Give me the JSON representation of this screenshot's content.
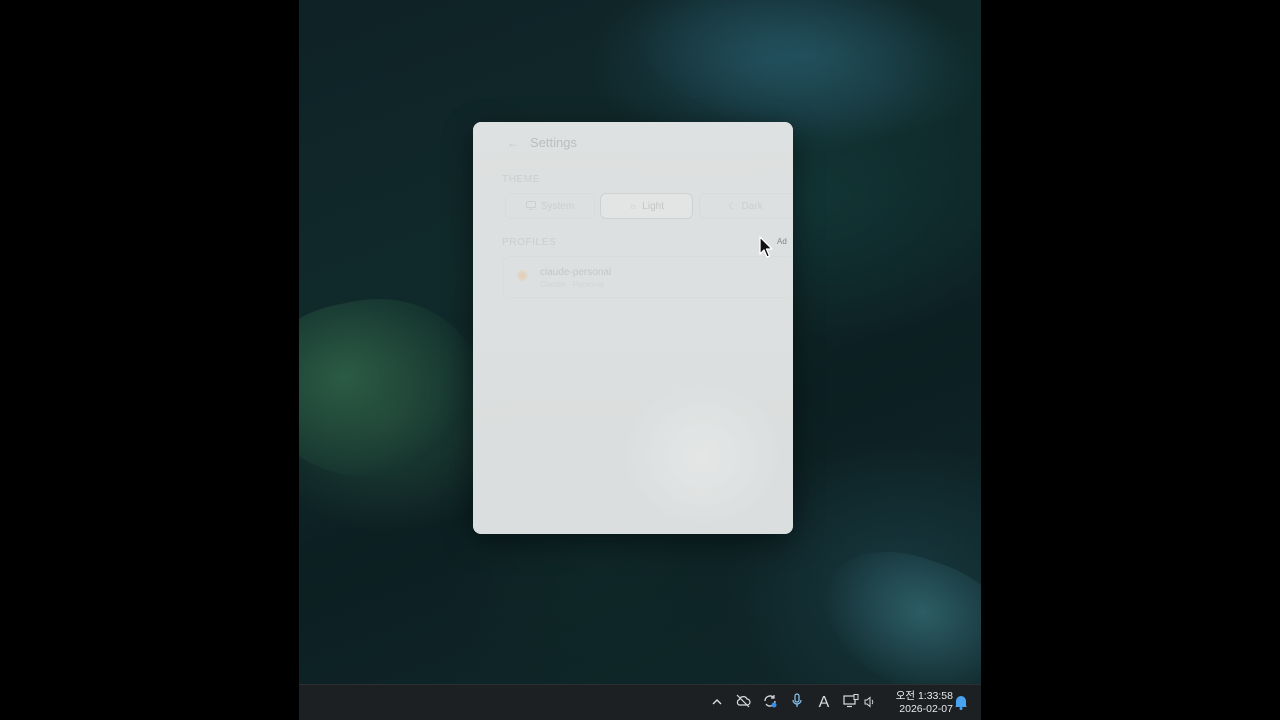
{
  "settings": {
    "title": "Settings",
    "theme_label": "THEME",
    "theme_options": [
      {
        "label": "System",
        "icon": "monitor-icon",
        "selected": false
      },
      {
        "label": "Light",
        "icon": "sun-icon",
        "selected": true
      },
      {
        "label": "Dark",
        "icon": "moon-icon",
        "selected": false
      }
    ],
    "profiles_label": "PROFILES",
    "add_label": "Ad",
    "profiles": [
      {
        "name": "claude-personal",
        "sub": "Claude · Personal"
      }
    ]
  },
  "taskbar": {
    "clock_time": "오전 1:33:58",
    "clock_date": "2026-02-07",
    "tray_icons": [
      "chevron-up-icon",
      "cloud-off-icon",
      "sync-icon",
      "microphone-icon",
      "ime-icon",
      "network-icon",
      "volume-icon",
      "notification-bell-icon"
    ],
    "ime_label": "A"
  },
  "colors": {
    "panel": "#dfe2e2",
    "taskbar": "#1c2022",
    "accent_bell": "#4aa3f0"
  }
}
